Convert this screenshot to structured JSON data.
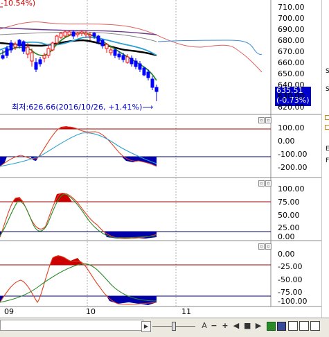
{
  "top_label": "-10.54%)",
  "low_annotation": "최저:626.66(2016/10/26, +1.41%)⟶",
  "price_badge": {
    "value": "635.51",
    "change": "(-0.73%)"
  },
  "price_axis": [
    "710.00",
    "700.00",
    "690.00",
    "680.00",
    "670.00",
    "660.00",
    "650.00",
    "640.00",
    "630.00",
    "620.00"
  ],
  "osc1_axis": [
    "100.00",
    "0.00",
    "-100.00",
    "-200.00"
  ],
  "osc2_axis": [
    "100.00",
    "75.00",
    "50.00",
    "25.00",
    "0.00"
  ],
  "osc3_axis": [
    "0.00",
    "-25.00",
    "-50.00",
    "-75.00",
    "-100.00"
  ],
  "x_labels": [
    "09",
    "10",
    "11"
  ],
  "right_chars": [
    "S",
    "S",
    "E",
    "F"
  ],
  "toolbar": {
    "scroll_right_arrow": "▶",
    "zoom_out": "−",
    "zoom_in": "+",
    "prev": "◀",
    "stop": "■",
    "next": "▶",
    "font_label": "A"
  },
  "colors": {
    "up": "#ff0000",
    "down": "#0000ff",
    "ma_black": "#000000",
    "ma_green": "#2a8a2a",
    "ma_cyan": "#2aa0d0",
    "band_red": "#e05050",
    "band_purple": "#6a4a8a",
    "hline_red": "#a00000",
    "hline_navy": "#00006a"
  }
}
